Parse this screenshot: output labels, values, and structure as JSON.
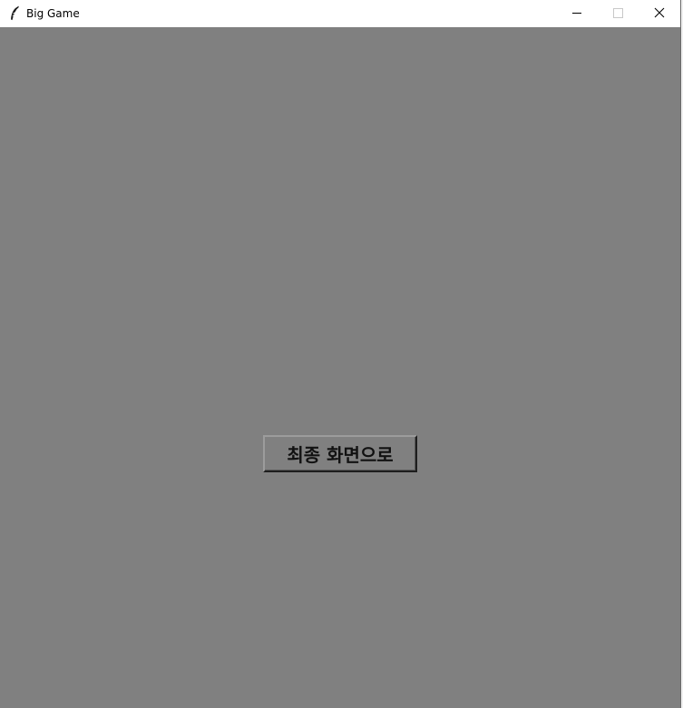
{
  "window": {
    "title": "Big Game",
    "icon": "feather-icon"
  },
  "controls": {
    "minimize_icon": "minimize-icon",
    "maximize_icon": "maximize-icon",
    "close_icon": "close-icon"
  },
  "main": {
    "button_label": "최종 화면으로",
    "background_color": "#808080"
  }
}
